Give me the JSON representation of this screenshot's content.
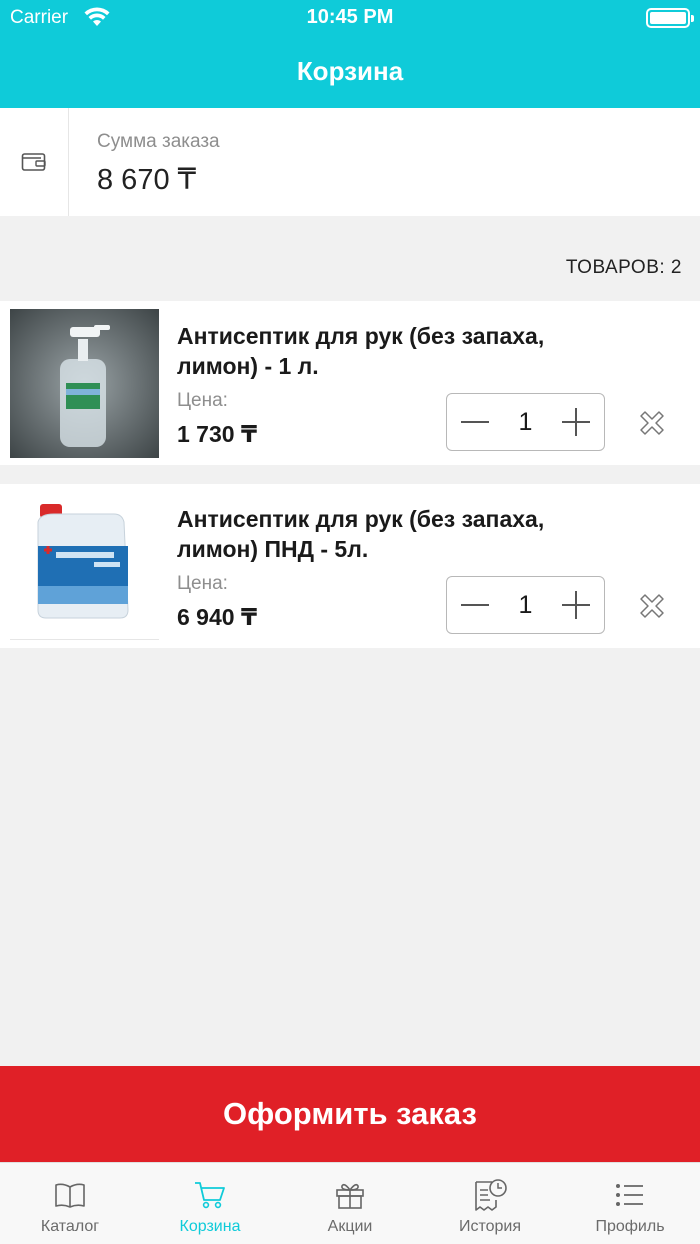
{
  "status_bar": {
    "carrier": "Carrier",
    "time": "10:45 PM"
  },
  "nav": {
    "title": "Корзина"
  },
  "summary": {
    "label": "Сумма заказа",
    "value": "8 670 ₸",
    "icon": "wallet-icon"
  },
  "items_count": "ТОВАРОВ: 2",
  "cart": {
    "items": [
      {
        "name": "Антисептик для рук (без запаха, лимон) - 1 л.",
        "price_label": "Цена:",
        "price": "1 730 ₸",
        "quantity": "1"
      },
      {
        "name": "Антисептик для рук (без запаха, лимон) ПНД - 5л.",
        "price_label": "Цена:",
        "price": "6 940 ₸",
        "quantity": "1"
      }
    ]
  },
  "checkout_label": "Оформить заказ",
  "tabs": [
    {
      "label": "Каталог",
      "icon": "book-icon"
    },
    {
      "label": "Корзина",
      "icon": "cart-icon"
    },
    {
      "label": "Акции",
      "icon": "gift-icon"
    },
    {
      "label": "История",
      "icon": "receipt-clock-icon"
    },
    {
      "label": "Профиль",
      "icon": "list-icon"
    }
  ],
  "colors": {
    "accent": "#0fcbd9",
    "checkout": "#e02027",
    "tab_inactive": "#6b6b6b"
  }
}
